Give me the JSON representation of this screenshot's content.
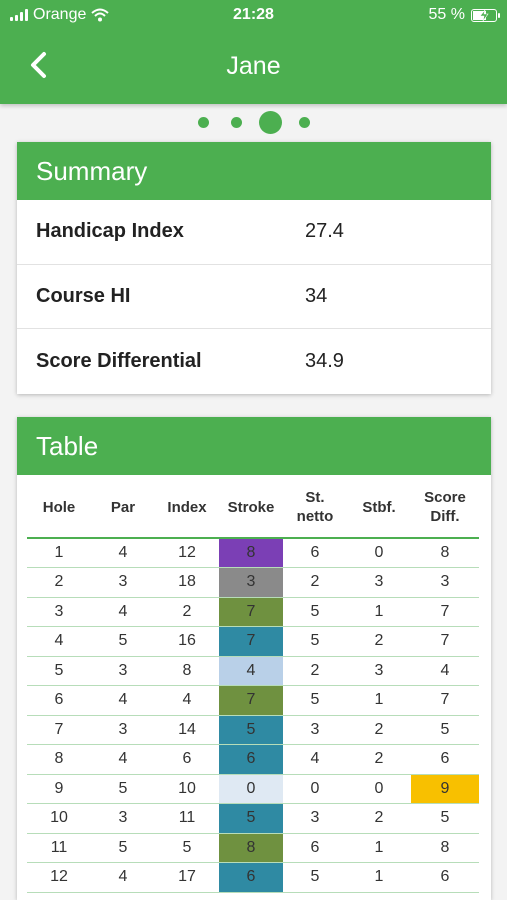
{
  "status_bar": {
    "carrier": "Orange",
    "time": "21:28",
    "battery": "55 %"
  },
  "header": {
    "title": "Jane",
    "back_icon": "chevron-left-icon"
  },
  "pager": {
    "count": 4,
    "active": 2
  },
  "summary": {
    "title": "Summary",
    "rows": [
      {
        "label": "Handicap Index",
        "value": "27.4"
      },
      {
        "label": "Course HI",
        "value": "34"
      },
      {
        "label": "Score Differential",
        "value": "34.9"
      }
    ]
  },
  "table": {
    "title": "Table",
    "columns": [
      [
        "Hole"
      ],
      [
        "Par"
      ],
      [
        "Index"
      ],
      [
        "Stroke"
      ],
      [
        "St.",
        "netto"
      ],
      [
        "Stbf."
      ],
      [
        "Score",
        "Diff."
      ]
    ],
    "rows": [
      {
        "hole": "1",
        "par": "4",
        "index": "12",
        "stroke": "8",
        "netto": "6",
        "stbf": "0",
        "diff": "8",
        "stroke_color": "#7b3fb5"
      },
      {
        "hole": "2",
        "par": "3",
        "index": "18",
        "stroke": "3",
        "netto": "2",
        "stbf": "3",
        "diff": "3",
        "stroke_color": "#8a8a8a"
      },
      {
        "hole": "3",
        "par": "4",
        "index": "2",
        "stroke": "7",
        "netto": "5",
        "stbf": "1",
        "diff": "7",
        "stroke_color": "#6f9140"
      },
      {
        "hole": "4",
        "par": "5",
        "index": "16",
        "stroke": "7",
        "netto": "5",
        "stbf": "2",
        "diff": "7",
        "stroke_color": "#2f8aa3"
      },
      {
        "hole": "5",
        "par": "3",
        "index": "8",
        "stroke": "4",
        "netto": "2",
        "stbf": "3",
        "diff": "4",
        "stroke_color": "#b9d0e8"
      },
      {
        "hole": "6",
        "par": "4",
        "index": "4",
        "stroke": "7",
        "netto": "5",
        "stbf": "1",
        "diff": "7",
        "stroke_color": "#6f9140"
      },
      {
        "hole": "7",
        "par": "3",
        "index": "14",
        "stroke": "5",
        "netto": "3",
        "stbf": "2",
        "diff": "5",
        "stroke_color": "#2f8aa3"
      },
      {
        "hole": "8",
        "par": "4",
        "index": "6",
        "stroke": "6",
        "netto": "4",
        "stbf": "2",
        "diff": "6",
        "stroke_color": "#2f8aa3"
      },
      {
        "hole": "9",
        "par": "5",
        "index": "10",
        "stroke": "0",
        "netto": "0",
        "stbf": "0",
        "diff": "9",
        "stroke_color": "#dfe9f3",
        "diff_color": "#f8c000"
      },
      {
        "hole": "10",
        "par": "3",
        "index": "11",
        "stroke": "5",
        "netto": "3",
        "stbf": "2",
        "diff": "5",
        "stroke_color": "#2f8aa3"
      },
      {
        "hole": "11",
        "par": "5",
        "index": "5",
        "stroke": "8",
        "netto": "6",
        "stbf": "1",
        "diff": "8",
        "stroke_color": "#6f9140"
      },
      {
        "hole": "12",
        "par": "4",
        "index": "17",
        "stroke": "6",
        "netto": "5",
        "stbf": "1",
        "diff": "6",
        "stroke_color": "#2f8aa3"
      }
    ]
  },
  "colors": {
    "primary": "#4caf50"
  }
}
